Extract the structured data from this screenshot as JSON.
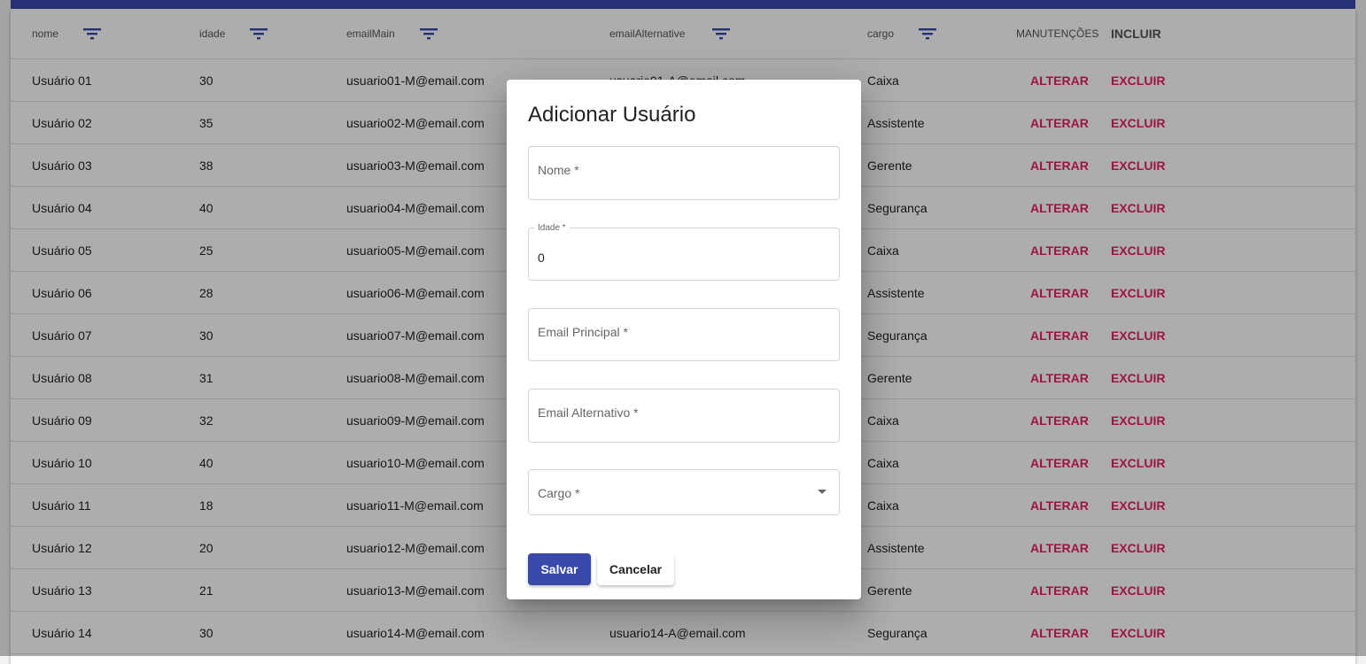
{
  "table": {
    "headers": {
      "nome": "nome",
      "idade": "idade",
      "emailMain": "emailMain",
      "emailAlternative": "emailAlternative",
      "cargo": "cargo",
      "manutencoes": "MANUTENÇÕES",
      "incluir": "INCLUIR"
    },
    "rows": [
      {
        "nome": "Usuário 01",
        "idade": "30",
        "emailMain": "usuario01-M@email.com",
        "emailAlternative": "usuario01-A@email.com",
        "cargo": "Caixa",
        "alterar": "ALTERAR",
        "excluir": "EXCLUIR"
      },
      {
        "nome": "Usuário 02",
        "idade": "35",
        "emailMain": "usuario02-M@email.com",
        "emailAlternative": "",
        "cargo": "Assistente",
        "alterar": "ALTERAR",
        "excluir": "EXCLUIR"
      },
      {
        "nome": "Usuário 03",
        "idade": "38",
        "emailMain": "usuario03-M@email.com",
        "emailAlternative": "",
        "cargo": "Gerente",
        "alterar": "ALTERAR",
        "excluir": "EXCLUIR"
      },
      {
        "nome": "Usuário 04",
        "idade": "40",
        "emailMain": "usuario04-M@email.com",
        "emailAlternative": "",
        "cargo": "Segurança",
        "alterar": "ALTERAR",
        "excluir": "EXCLUIR"
      },
      {
        "nome": "Usuário 05",
        "idade": "25",
        "emailMain": "usuario05-M@email.com",
        "emailAlternative": "",
        "cargo": "Caixa",
        "alterar": "ALTERAR",
        "excluir": "EXCLUIR"
      },
      {
        "nome": "Usuário 06",
        "idade": "28",
        "emailMain": "usuario06-M@email.com",
        "emailAlternative": "",
        "cargo": "Assistente",
        "alterar": "ALTERAR",
        "excluir": "EXCLUIR"
      },
      {
        "nome": "Usuário 07",
        "idade": "30",
        "emailMain": "usuario07-M@email.com",
        "emailAlternative": "",
        "cargo": "Segurança",
        "alterar": "ALTERAR",
        "excluir": "EXCLUIR"
      },
      {
        "nome": "Usuário 08",
        "idade": "31",
        "emailMain": "usuario08-M@email.com",
        "emailAlternative": "",
        "cargo": "Gerente",
        "alterar": "ALTERAR",
        "excluir": "EXCLUIR"
      },
      {
        "nome": "Usuário 09",
        "idade": "32",
        "emailMain": "usuario09-M@email.com",
        "emailAlternative": "",
        "cargo": "Caixa",
        "alterar": "ALTERAR",
        "excluir": "EXCLUIR"
      },
      {
        "nome": "Usuário 10",
        "idade": "40",
        "emailMain": "usuario10-M@email.com",
        "emailAlternative": "",
        "cargo": "Caixa",
        "alterar": "ALTERAR",
        "excluir": "EXCLUIR"
      },
      {
        "nome": "Usuário 11",
        "idade": "18",
        "emailMain": "usuario11-M@email.com",
        "emailAlternative": "",
        "cargo": "Caixa",
        "alterar": "ALTERAR",
        "excluir": "EXCLUIR"
      },
      {
        "nome": "Usuário 12",
        "idade": "20",
        "emailMain": "usuario12-M@email.com",
        "emailAlternative": "",
        "cargo": "Assistente",
        "alterar": "ALTERAR",
        "excluir": "EXCLUIR"
      },
      {
        "nome": "Usuário 13",
        "idade": "21",
        "emailMain": "usuario13-M@email.com",
        "emailAlternative": "",
        "cargo": "Gerente",
        "alterar": "ALTERAR",
        "excluir": "EXCLUIR"
      },
      {
        "nome": "Usuário 14",
        "idade": "30",
        "emailMain": "usuario14-M@email.com",
        "emailAlternative": "usuario14-A@email.com",
        "cargo": "Segurança",
        "alterar": "ALTERAR",
        "excluir": "EXCLUIR"
      }
    ]
  },
  "dialog": {
    "title": "Adicionar Usuário",
    "fields": {
      "nome": {
        "placeholder": "Nome *",
        "value": ""
      },
      "idade": {
        "label": "Idade *",
        "value": "0"
      },
      "emailPrincipal": {
        "placeholder": "Email Principal *",
        "value": ""
      },
      "emailAlternativo": {
        "placeholder": "Email Alternativo *",
        "value": ""
      },
      "cargo": {
        "placeholder": "Cargo *",
        "value": ""
      }
    },
    "buttons": {
      "save": "Salvar",
      "cancel": "Cancelar"
    }
  },
  "colors": {
    "primary": "#3949ab",
    "accent": "#e91e63",
    "backdrop": "rgba(0,0,0,0.32)"
  }
}
